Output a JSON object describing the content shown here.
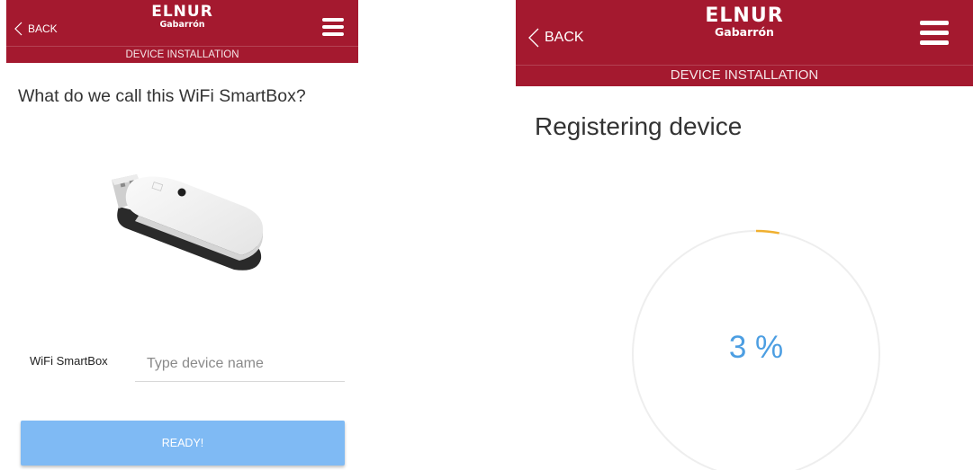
{
  "screens": {
    "left": {
      "header": {
        "back_label": "BACK",
        "logo_line1": "ELNUR",
        "logo_line2": "Gabarrón",
        "subtitle": "DEVICE INSTALLATION"
      },
      "question": "What do we call this WiFi SmartBox?",
      "field": {
        "label": "WiFi SmartBox",
        "value": "",
        "placeholder": "Type device name"
      },
      "ready_label": "READY!"
    },
    "right": {
      "header": {
        "back_label": "BACK",
        "logo_line1": "ELNUR",
        "logo_line2": "Gabarrón",
        "subtitle": "DEVICE INSTALLATION"
      },
      "status_title": "Registering device",
      "progress": {
        "percent": 3,
        "label": "3 %"
      }
    }
  },
  "icons": {
    "back": "chevron-left-icon",
    "menu": "hamburger-menu-icon",
    "device": "wifi-smartbox-dongle-icon"
  },
  "colors": {
    "header_bg": "#a4192f",
    "button_bg": "#7fbaf4",
    "progress_text": "#4c9ee2",
    "progress_arc": "#f0b030",
    "progress_track": "#eeeeee"
  }
}
